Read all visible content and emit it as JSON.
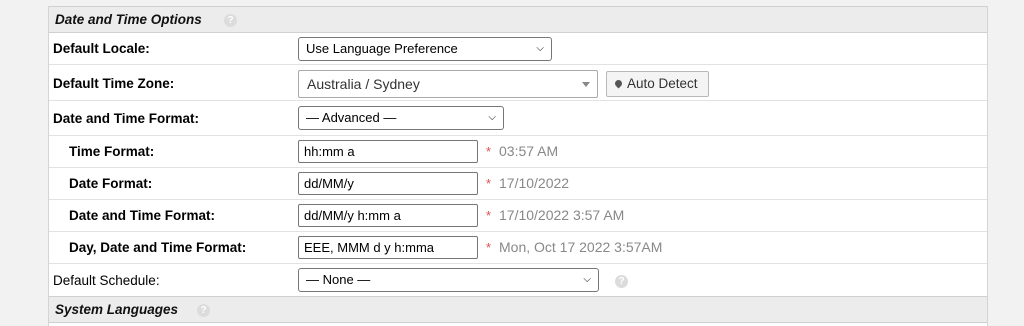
{
  "section": {
    "title": "Date and Time Options",
    "help_glyph": "?"
  },
  "rows": {
    "default_locale": {
      "label": "Default Locale:",
      "value": "Use Language Preference"
    },
    "default_time_zone": {
      "label": "Default Time Zone:",
      "value": "Australia / Sydney",
      "button": "Auto Detect"
    },
    "date_time_format_mode": {
      "label": "Date and Time Format:",
      "value": "— Advanced —"
    },
    "time_format": {
      "label": "Time Format:",
      "value": "hh:mm a",
      "required": "*",
      "preview": "03:57 AM"
    },
    "date_format": {
      "label": "Date Format:",
      "value": "dd/MM/y",
      "required": "*",
      "preview": "17/10/2022"
    },
    "date_time_format": {
      "label": "Date and Time Format:",
      "value": "dd/MM/y h:mm a",
      "required": "*",
      "preview": "17/10/2022 3:57 AM"
    },
    "day_date_time_format": {
      "label": "Day, Date and Time Format:",
      "value": "EEE, MMM d y h:mma",
      "required": "*",
      "preview": "Mon, Oct 17 2022 3:57AM"
    },
    "default_schedule": {
      "label": "Default Schedule:",
      "value": "— None —"
    }
  },
  "next_section": {
    "title": "System Languages"
  }
}
